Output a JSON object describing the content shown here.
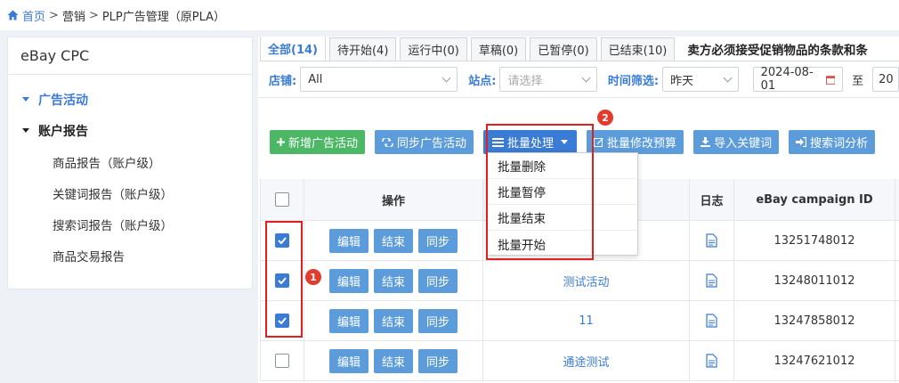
{
  "breadcrumb": {
    "home": "首页",
    "sep1": ">",
    "marketing": "营销",
    "sep2": ">",
    "current": "PLP广告管理（原PLA）"
  },
  "sidebar": {
    "title": "eBay CPC",
    "group_campaigns": "广告活动",
    "group_reports": "账户报告",
    "items": [
      {
        "label": "商品报告（账户级）"
      },
      {
        "label": "关键词报告（账户级）"
      },
      {
        "label": "搜索词报告（账户级）"
      },
      {
        "label": "商品交易报告"
      }
    ]
  },
  "tabs": [
    {
      "label": "全部(14)"
    },
    {
      "label": "待开始(4)"
    },
    {
      "label": "运行中(0)"
    },
    {
      "label": "草稿(0)"
    },
    {
      "label": "已暂停(0)"
    },
    {
      "label": "已结束(10)"
    }
  ],
  "notice": "卖方必须接受促销物品的条款和条",
  "filters": {
    "store_label": "店铺:",
    "store_value": "All",
    "site_label": "站点:",
    "site_placeholder": "请选择",
    "time_label": "时间筛选:",
    "time_value": "昨天",
    "date_from": "2024-08-01",
    "to_label": "至",
    "date_to": "20"
  },
  "toolbar": {
    "add": "新增广告活动",
    "sync": "同步广告活动",
    "batch": "批量处理",
    "budget": "批量修改预算",
    "import": "导入关键词",
    "search": "搜索词分析"
  },
  "batch_menu": [
    {
      "label": "批量删除"
    },
    {
      "label": "批量暂停"
    },
    {
      "label": "批量结束"
    },
    {
      "label": "批量开始"
    }
  ],
  "table": {
    "header": {
      "ops": "操作",
      "log": "日志",
      "id": "eBay campaign ID"
    },
    "rows": [
      {
        "checked": true,
        "edit": "编辑",
        "end": "结束",
        "sync": "同步",
        "name": "",
        "id": "13251748012"
      },
      {
        "checked": true,
        "edit": "编辑",
        "end": "结束",
        "sync": "同步",
        "name": "测试活动",
        "id": "13248011012"
      },
      {
        "checked": true,
        "edit": "编辑",
        "end": "结束",
        "sync": "同步",
        "name": "11",
        "id": "13247858012"
      },
      {
        "checked": false,
        "edit": "编辑",
        "end": "结束",
        "sync": "同步",
        "name": "通途测试",
        "id": "13247621012"
      }
    ]
  },
  "annotations": {
    "badge1": "1",
    "badge2": "2"
  },
  "colors": {
    "accent": "#3a7bd5",
    "green": "#4cb865",
    "red": "#e02020"
  }
}
